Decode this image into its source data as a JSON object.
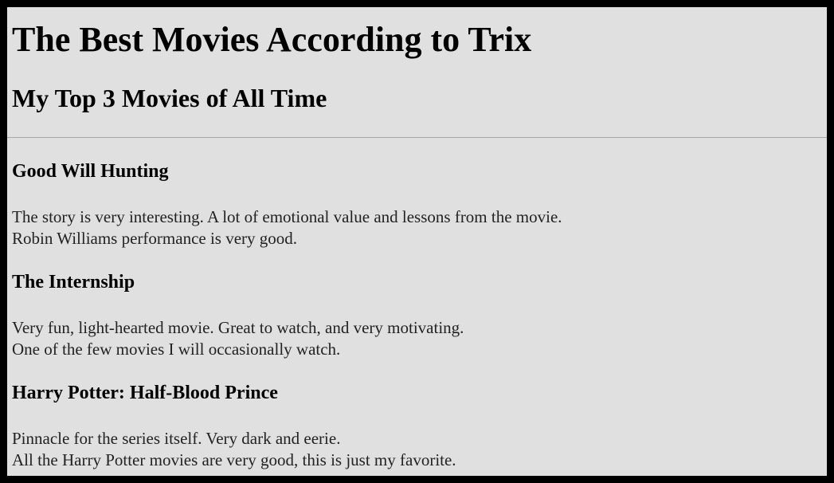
{
  "page": {
    "title": "The Best Movies According to Trix",
    "subtitle": "My Top 3 Movies of All Time"
  },
  "movies": [
    {
      "title": "Good Will Hunting",
      "line1": "The story is very interesting. A lot of emotional value and lessons from the movie.",
      "line2": "Robin Williams performance is very good."
    },
    {
      "title": "The Internship",
      "line1": "Very fun, light-hearted movie. Great to watch, and very motivating.",
      "line2": "One of the few movies I will occasionally watch."
    },
    {
      "title": "Harry Potter: Half-Blood Prince",
      "line1": "Pinnacle for the series itself. Very dark and eerie.",
      "line2": "All the Harry Potter movies are very good, this is just my favorite."
    }
  ],
  "colors": {
    "page_background": "#e0e0e0",
    "border": "#000000",
    "rule": "#a8a8a8"
  }
}
